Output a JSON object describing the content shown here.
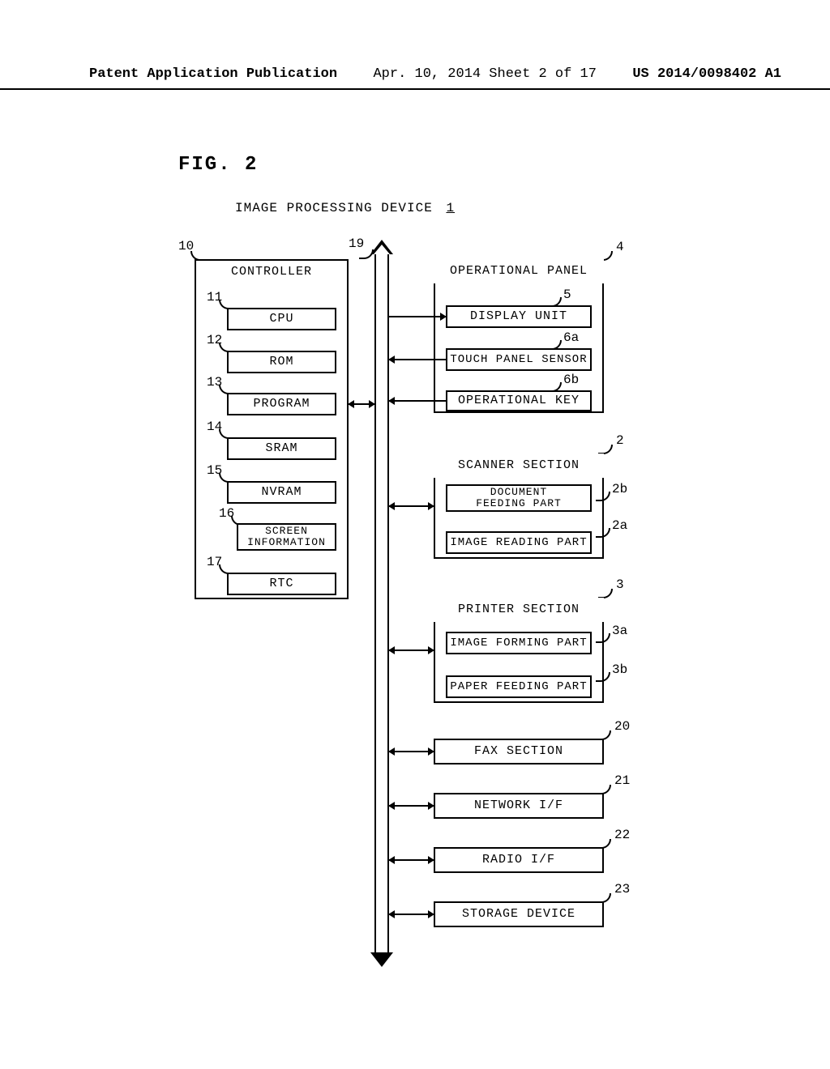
{
  "header": {
    "left": "Patent Application Publication",
    "center": "Apr. 10, 2014  Sheet 2 of 17",
    "right": "US 2014/0098402 A1"
  },
  "figure": {
    "label": "FIG.  2",
    "device_title": "IMAGE PROCESSING DEVICE",
    "device_ref_num": "1"
  },
  "refs": {
    "bus": "19",
    "controller": "10",
    "cpu": "11",
    "rom": "12",
    "program": "13",
    "sram": "14",
    "nvram": "15",
    "screen_info": "16",
    "rtc": "17",
    "op_panel": "4",
    "display_unit": "5",
    "touch_sensor": "6a",
    "op_key": "6b",
    "scanner": "2",
    "doc_feed": "2b",
    "img_read": "2a",
    "printer": "3",
    "img_form": "3a",
    "paper_feed": "3b",
    "fax": "20",
    "net_if": "21",
    "radio_if": "22",
    "storage": "23"
  },
  "labels": {
    "controller": "CONTROLLER",
    "cpu": "CPU",
    "rom": "ROM",
    "program": "PROGRAM",
    "sram": "SRAM",
    "nvram": "NVRAM",
    "screen_info": "SCREEN\nINFORMATION",
    "rtc": "RTC",
    "op_panel": "OPERATIONAL PANEL",
    "display_unit": "DISPLAY UNIT",
    "touch_sensor": "TOUCH PANEL SENSOR",
    "op_key": "OPERATIONAL KEY",
    "scanner": "SCANNER SECTION",
    "doc_feed": "DOCUMENT\nFEEDING PART",
    "img_read": "IMAGE READING PART",
    "printer": "PRINTER SECTION",
    "img_form": "IMAGE FORMING PART",
    "paper_feed": "PAPER FEEDING PART",
    "fax": "FAX SECTION",
    "net_if": "NETWORK  I/F",
    "radio_if": "RADIO  I/F",
    "storage": "STORAGE DEVICE"
  }
}
